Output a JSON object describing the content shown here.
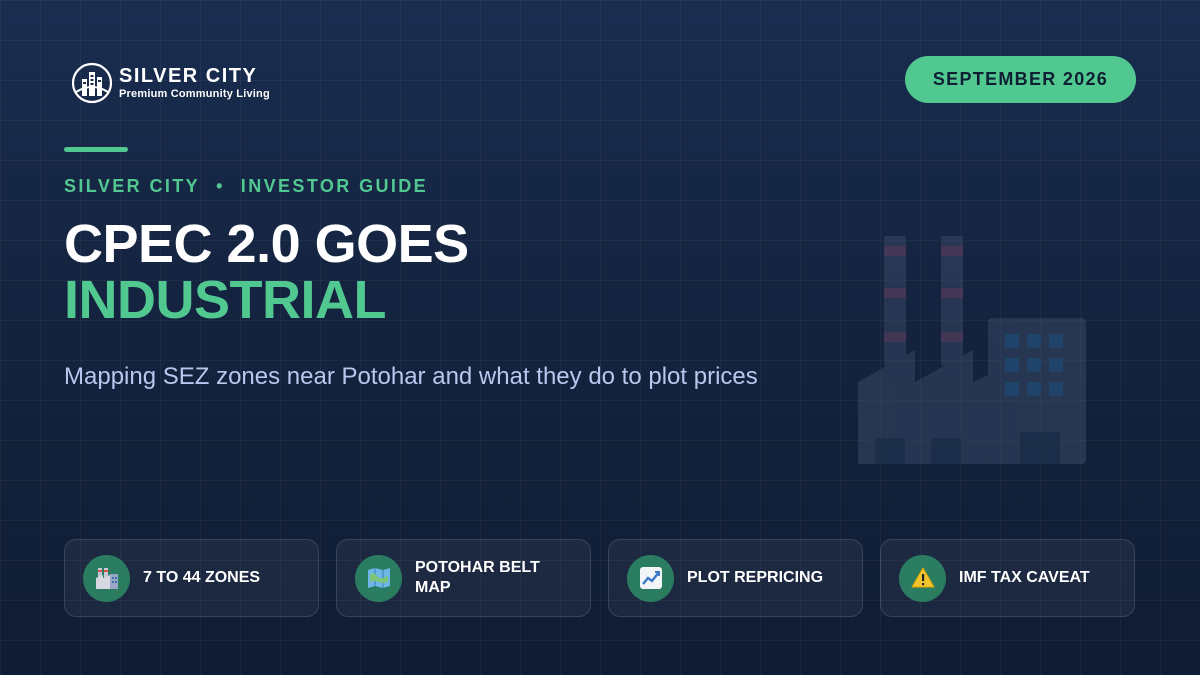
{
  "brand": {
    "name": "SILVER CITY",
    "tagline": "Premium Community Living"
  },
  "date_badge": "SEPTEMBER 2026",
  "kicker": {
    "left": "SILVER CITY",
    "separator": "•",
    "right": "INVESTOR GUIDE"
  },
  "title": {
    "line1": "CPEC 2.0 GOES",
    "line2": "INDUSTRIAL"
  },
  "subtitle": "Mapping SEZ zones near Potohar and what they do to plot prices",
  "cards": [
    {
      "label": "7 TO 44 ZONES",
      "icon": "factory-icon"
    },
    {
      "label": "POTOHAR BELT MAP",
      "icon": "map-icon"
    },
    {
      "label": "PLOT REPRICING",
      "icon": "chart-up-icon"
    },
    {
      "label": "IMF TAX CAVEAT",
      "icon": "warning-icon"
    }
  ],
  "colors": {
    "accent": "#52c891",
    "background": "#14233f",
    "icon_circle": "#2a7d60",
    "subtitle": "#b9c7ee"
  }
}
